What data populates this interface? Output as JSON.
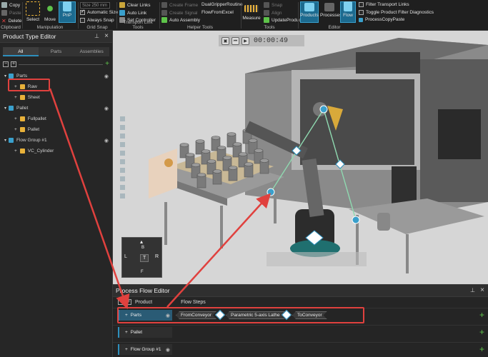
{
  "ribbon": {
    "clipboard": {
      "copy": "Copy",
      "paste": "Paste",
      "delete": "Delete",
      "label": "Clipboard"
    },
    "manipulation": {
      "select": "Select",
      "move": "Move",
      "pnp": "PnP",
      "label": "Manipulation"
    },
    "grid_snap": {
      "size_placeholder": "Size  250  mm",
      "automatic_size": "Automatic Size",
      "always_snap": "Always Snap",
      "label": "Grid Snap"
    },
    "transport_link_tools": {
      "clear_links": "Clear Links",
      "auto_link": "Auto Link",
      "set_controller": "Set Controller",
      "label": "Transport Link Tools"
    },
    "helper_tools": {
      "create_frame": "Create Frame",
      "create_signal": "Create Signal",
      "auto_assembly": "Auto Assembly",
      "dual_gripper": "DualGripperRoutine",
      "flow_from_excel": "FlowFromExcel",
      "label": "Helper Tools"
    },
    "tools": {
      "measure": "Measure",
      "snap": "Snap",
      "align": "Align",
      "update_products": "UpdateProducts",
      "label": "Tools"
    },
    "editor": {
      "products": "Products",
      "processes": "Processes",
      "flow": "Flow",
      "filter_links": "Filter Transport Links",
      "toggle_diag": "Toggle Product Filter Diagnostics",
      "process_copy": "ProcessCopyPaste",
      "label": "Editor"
    }
  },
  "product_type_editor": {
    "title": "Product Type Editor",
    "tabs": [
      "All",
      "Parts",
      "Assemblies"
    ],
    "tree": [
      {
        "label": "Parts",
        "level": 0
      },
      {
        "label": "Raw",
        "level": 1
      },
      {
        "label": "Sheet",
        "level": 1
      },
      {
        "label": "Pallet",
        "level": 0
      },
      {
        "label": "Fullpallet",
        "level": 1
      },
      {
        "label": "Pallet",
        "level": 1
      },
      {
        "label": "Flow Group #1",
        "level": 0
      },
      {
        "label": "VC_Cylinder",
        "level": 1
      }
    ]
  },
  "viewport": {
    "time": "00:00:49",
    "nav": {
      "top": "T",
      "left": "L",
      "right": "R",
      "back": "B",
      "front": "F"
    }
  },
  "process_flow_editor": {
    "title": "Process Flow Editor",
    "col_product": "Product",
    "col_flow_steps": "Flow Steps",
    "rows": [
      {
        "name": "Parts",
        "steps": [
          "FromConveyor",
          "Parametric 5-axis Lathe",
          "ToConveyor"
        ]
      },
      {
        "name": "Pallet",
        "steps": []
      },
      {
        "name": "Flow Group #1",
        "steps": []
      }
    ]
  },
  "colors": {
    "accent": "#2d8fbd",
    "highlight": "#e0413e",
    "add": "#5ec34a"
  }
}
